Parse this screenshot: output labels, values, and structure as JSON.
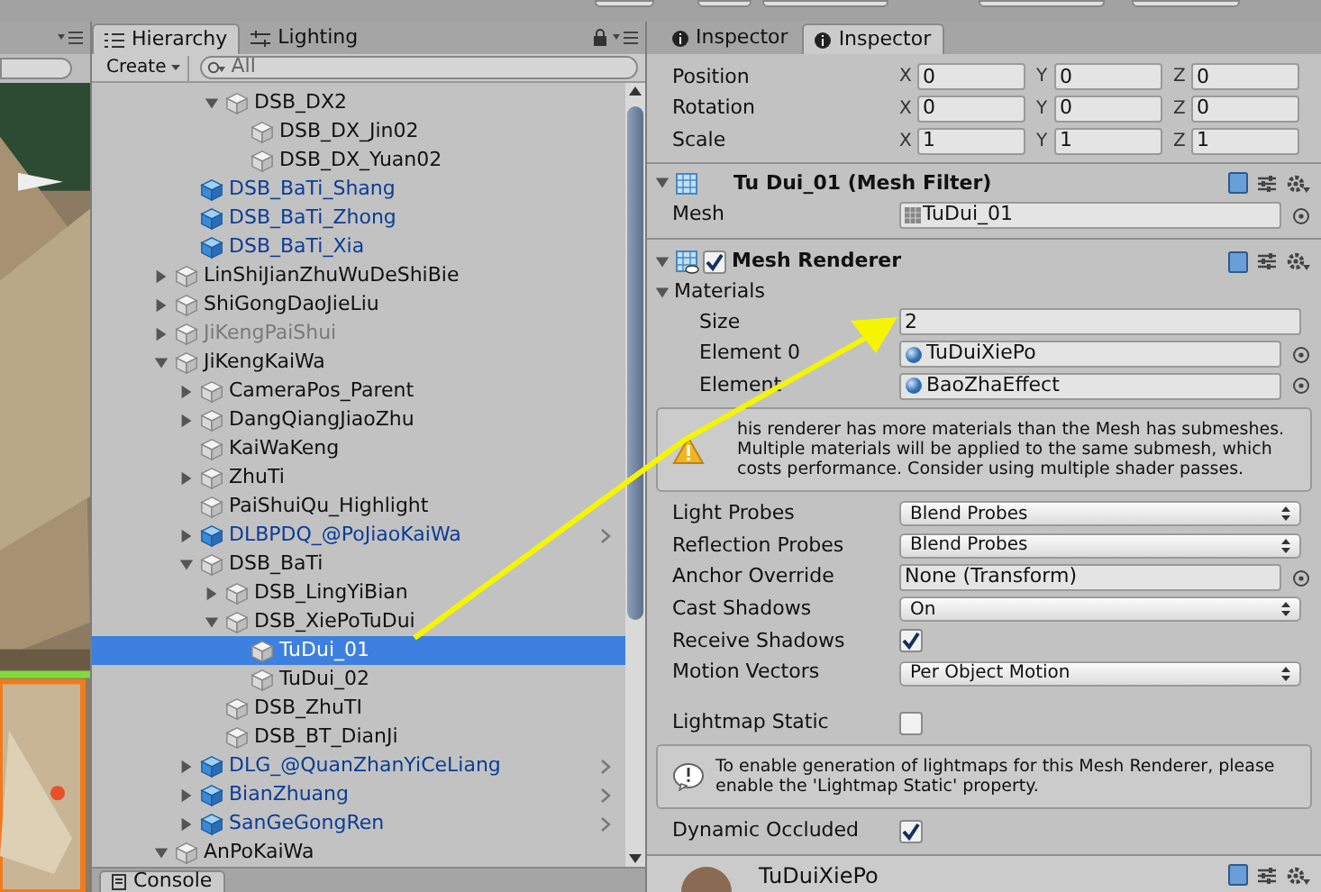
{
  "hierarchy": {
    "tabs": [
      {
        "label": "Hierarchy",
        "selected": true
      },
      {
        "label": "Lighting",
        "selected": false
      }
    ],
    "create_button": "Create",
    "search": {
      "placeholder": "All"
    },
    "items": [
      {
        "children": [
          {
            "children": [
              {
                "name": "DSB_DX2",
                "expanded": true,
                "children": [
                  {
                    "name": "DSB_DX_Jin02"
                  },
                  {
                    "name": "DSB_DX_Yuan02"
                  }
                ]
              }
            ]
          },
          {
            "name": "DSB_BaTi_Shang",
            "prefab": true
          },
          {
            "name": "DSB_BaTi_Zhong",
            "prefab": true
          },
          {
            "name": "DSB_BaTi_Xia",
            "prefab": true
          }
        ]
      },
      {
        "name": "LinShiJianZhuWuDeShiBie",
        "expanded": false
      },
      {
        "name": "ShiGongDaoJieLiu",
        "expanded": false
      },
      {
        "name": "JiKengPaiShui",
        "expanded": false,
        "disabled": true
      },
      {
        "name": "JiKengKaiWa",
        "expanded": true,
        "children": [
          {
            "name": "CameraPos_Parent",
            "expanded": false
          },
          {
            "name": "DangQiangJiaoZhu",
            "expanded": false
          },
          {
            "name": "KaiWaKeng"
          },
          {
            "name": "ZhuTi",
            "expanded": false
          },
          {
            "name": "PaiShuiQu_Highlight"
          },
          {
            "name": "DLBPDQ_@PoJiaoKaiWa",
            "expanded": false,
            "prefab": true,
            "prefab_root": true
          },
          {
            "name": "DSB_BaTi",
            "expanded": true,
            "children": [
              {
                "name": "DSB_LingYiBian",
                "expanded": false
              },
              {
                "name": "DSB_XiePoTuDui",
                "expanded": true,
                "children": [
                  {
                    "name": "TuDui_01",
                    "selected": true
                  },
                  {
                    "name": "TuDui_02",
                    "selected": false
                  }
                ]
              },
              {
                "name": "DSB_ZhuTI"
              },
              {
                "name": "DSB_BT_DianJi"
              }
            ]
          },
          {
            "name": "DLG_@QuanZhanYiCeLiang",
            "expanded": false,
            "prefab": true,
            "prefab_root": true
          },
          {
            "name": "BianZhuang",
            "expanded": false,
            "prefab": true,
            "prefab_root": true
          },
          {
            "name": "SanGeGongRen",
            "expanded": false,
            "prefab": true,
            "prefab_root": true
          }
        ]
      },
      {
        "name": "AnPoKaiWa",
        "expanded": true
      }
    ]
  },
  "console_tab": "Console",
  "inspector": {
    "tabs": [
      {
        "label": "Inspector",
        "selected": false
      },
      {
        "label": "Inspector",
        "selected": true
      }
    ],
    "transform": {
      "rows": [
        {
          "label": "Position",
          "fields": [
            {
              "axis": "X",
              "value": "0"
            },
            {
              "axis": "Y",
              "value": "0"
            },
            {
              "axis": "Z",
              "value": "0"
            }
          ]
        },
        {
          "label": "Rotation",
          "fields": [
            {
              "axis": "X",
              "value": "0"
            },
            {
              "axis": "Y",
              "value": "0"
            },
            {
              "axis": "Z",
              "value": "0"
            }
          ]
        },
        {
          "label": "Scale",
          "fields": [
            {
              "axis": "X",
              "value": "1"
            },
            {
              "axis": "Y",
              "value": "1"
            },
            {
              "axis": "Z",
              "value": "1"
            }
          ]
        }
      ]
    },
    "mesh_filter": {
      "title": "Tu Dui_01 (Mesh Filter)",
      "expanded": true,
      "mesh_label": "Mesh",
      "mesh_value": "TuDui_01"
    },
    "mesh_renderer": {
      "title": "Mesh Renderer",
      "expanded": true,
      "enabled": true,
      "materials": {
        "label": "Materials",
        "expanded": true,
        "size_label": "Size",
        "size": "2",
        "elements": [
          {
            "label": "Element 0",
            "value": "TuDuiXiePo"
          },
          {
            "label": "Element",
            "value": "BaoZhaEffect"
          }
        ]
      },
      "warning": "his renderer has more materials than the Mesh has submeshes. Multiple materials will be applied to the same submesh, which costs performance. Consider using multiple shader passes.",
      "properties": [
        {
          "kind": "dropdown",
          "label": "Light Probes",
          "value": "Blend Probes"
        },
        {
          "kind": "dropdown",
          "label": "Reflection Probes",
          "value": "Blend Probes"
        },
        {
          "kind": "object",
          "label": "Anchor Override",
          "value": "None (Transform)"
        },
        {
          "kind": "dropdown",
          "label": "Cast Shadows",
          "value": "On"
        },
        {
          "kind": "checkbox",
          "label": "Receive Shadows",
          "checked": true
        },
        {
          "kind": "dropdown",
          "label": "Motion Vectors",
          "value": "Per Object Motion"
        }
      ],
      "lightmap_static": {
        "label": "Lightmap Static",
        "checked": false
      },
      "info": "To enable generation of lightmaps for this Mesh Renderer, please enable the 'Lightmap Static' property.",
      "dynamic_occluded": {
        "label": "Dynamic Occluded",
        "checked": true
      }
    },
    "material_header": {
      "name": "TuDuiXiePo"
    }
  }
}
